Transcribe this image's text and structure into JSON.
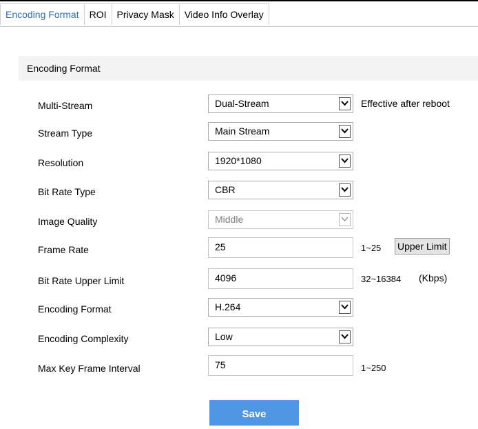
{
  "tabs": [
    {
      "label": "Encoding Format",
      "active": true
    },
    {
      "label": "ROI",
      "active": false
    },
    {
      "label": "Privacy Mask",
      "active": false
    },
    {
      "label": "Video Info Overlay",
      "active": false
    }
  ],
  "section": {
    "title": "Encoding Format"
  },
  "fields": {
    "multi_stream": {
      "label": "Multi-Stream",
      "value": "Dual-Stream",
      "note": "Effective after reboot"
    },
    "stream_type": {
      "label": "Stream Type",
      "value": "Main Stream"
    },
    "resolution": {
      "label": "Resolution",
      "value": "1920*1080"
    },
    "bit_rate_type": {
      "label": "Bit Rate Type",
      "value": "CBR"
    },
    "image_quality": {
      "label": "Image Quality",
      "value": "Middle",
      "disabled": true
    },
    "frame_rate": {
      "label": "Frame Rate",
      "value": "25",
      "range": "1~25",
      "button": "Upper Limit"
    },
    "bit_rate_upper_limit": {
      "label": "Bit Rate Upper Limit",
      "value": "4096",
      "range": "32~16384",
      "unit": "(Kbps)"
    },
    "encoding_format": {
      "label": "Encoding Format",
      "value": "H.264"
    },
    "encoding_complexity": {
      "label": "Encoding Complexity",
      "value": "Low"
    },
    "max_key_frame_interval": {
      "label": "Max Key Frame Interval",
      "value": "75",
      "range": "1~250"
    }
  },
  "actions": {
    "save_label": "Save"
  },
  "colors": {
    "accent": "#4f97e3",
    "active_tab": "#2e6fb7",
    "header_bg": "#f4f4f4"
  }
}
